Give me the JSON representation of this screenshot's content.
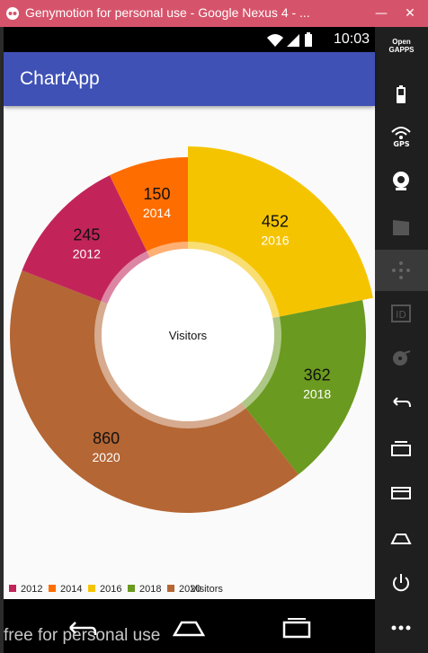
{
  "window": {
    "title": "Genymotion for personal use - Google Nexus 4 - ...",
    "minimize": "—",
    "close": "✕"
  },
  "statusbar": {
    "time": "10:03"
  },
  "appbar": {
    "title": "ChartApp"
  },
  "watermark": "free for personal use",
  "sidebar": {
    "opengapps_label_1": "Open",
    "opengapps_label_2": "GAPPS",
    "gps_label": "GPS",
    "id_label": "ID"
  },
  "chart_data": {
    "type": "pie",
    "center_text": "Visitors",
    "legend_position": "bottom-left",
    "legend_suffix": "Visitors",
    "slices": [
      {
        "label": "2016",
        "value": 452,
        "color": "#f5c400"
      },
      {
        "label": "2018",
        "value": 362,
        "color": "#6a9a1f"
      },
      {
        "label": "2020",
        "value": 860,
        "color": "#b46634"
      },
      {
        "label": "2012",
        "value": 245,
        "color": "#c2245a"
      },
      {
        "label": "2014",
        "value": 150,
        "color": "#fe6d00"
      }
    ],
    "legend": [
      {
        "label": "2012",
        "color": "#c2245a"
      },
      {
        "label": "2014",
        "color": "#fe6d00"
      },
      {
        "label": "2016",
        "color": "#f5c400"
      },
      {
        "label": "2018",
        "color": "#6a9a1f"
      },
      {
        "label": "2020",
        "color": "#b46634"
      }
    ]
  }
}
